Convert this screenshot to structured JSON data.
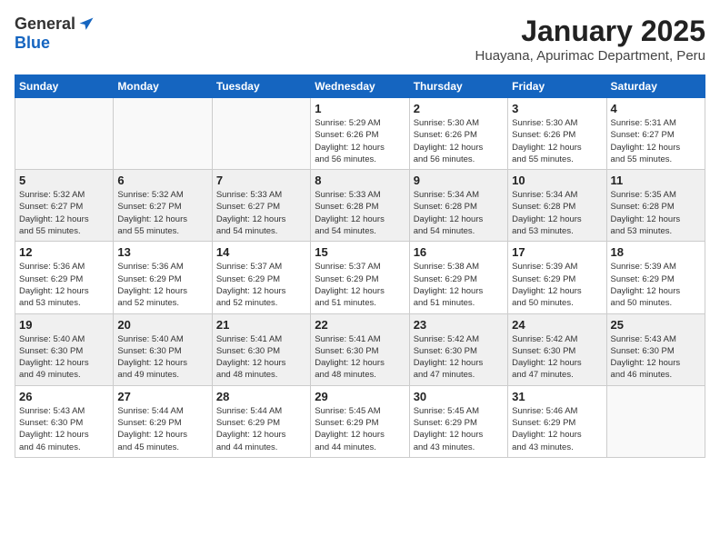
{
  "header": {
    "logo_general": "General",
    "logo_blue": "Blue",
    "month_title": "January 2025",
    "subtitle": "Huayana, Apurimac Department, Peru"
  },
  "weekdays": [
    "Sunday",
    "Monday",
    "Tuesday",
    "Wednesday",
    "Thursday",
    "Friday",
    "Saturday"
  ],
  "weeks": [
    {
      "shaded": false,
      "days": [
        {
          "num": "",
          "info": ""
        },
        {
          "num": "",
          "info": ""
        },
        {
          "num": "",
          "info": ""
        },
        {
          "num": "1",
          "info": "Sunrise: 5:29 AM\nSunset: 6:26 PM\nDaylight: 12 hours\nand 56 minutes."
        },
        {
          "num": "2",
          "info": "Sunrise: 5:30 AM\nSunset: 6:26 PM\nDaylight: 12 hours\nand 56 minutes."
        },
        {
          "num": "3",
          "info": "Sunrise: 5:30 AM\nSunset: 6:26 PM\nDaylight: 12 hours\nand 55 minutes."
        },
        {
          "num": "4",
          "info": "Sunrise: 5:31 AM\nSunset: 6:27 PM\nDaylight: 12 hours\nand 55 minutes."
        }
      ]
    },
    {
      "shaded": true,
      "days": [
        {
          "num": "5",
          "info": "Sunrise: 5:32 AM\nSunset: 6:27 PM\nDaylight: 12 hours\nand 55 minutes."
        },
        {
          "num": "6",
          "info": "Sunrise: 5:32 AM\nSunset: 6:27 PM\nDaylight: 12 hours\nand 55 minutes."
        },
        {
          "num": "7",
          "info": "Sunrise: 5:33 AM\nSunset: 6:27 PM\nDaylight: 12 hours\nand 54 minutes."
        },
        {
          "num": "8",
          "info": "Sunrise: 5:33 AM\nSunset: 6:28 PM\nDaylight: 12 hours\nand 54 minutes."
        },
        {
          "num": "9",
          "info": "Sunrise: 5:34 AM\nSunset: 6:28 PM\nDaylight: 12 hours\nand 54 minutes."
        },
        {
          "num": "10",
          "info": "Sunrise: 5:34 AM\nSunset: 6:28 PM\nDaylight: 12 hours\nand 53 minutes."
        },
        {
          "num": "11",
          "info": "Sunrise: 5:35 AM\nSunset: 6:28 PM\nDaylight: 12 hours\nand 53 minutes."
        }
      ]
    },
    {
      "shaded": false,
      "days": [
        {
          "num": "12",
          "info": "Sunrise: 5:36 AM\nSunset: 6:29 PM\nDaylight: 12 hours\nand 53 minutes."
        },
        {
          "num": "13",
          "info": "Sunrise: 5:36 AM\nSunset: 6:29 PM\nDaylight: 12 hours\nand 52 minutes."
        },
        {
          "num": "14",
          "info": "Sunrise: 5:37 AM\nSunset: 6:29 PM\nDaylight: 12 hours\nand 52 minutes."
        },
        {
          "num": "15",
          "info": "Sunrise: 5:37 AM\nSunset: 6:29 PM\nDaylight: 12 hours\nand 51 minutes."
        },
        {
          "num": "16",
          "info": "Sunrise: 5:38 AM\nSunset: 6:29 PM\nDaylight: 12 hours\nand 51 minutes."
        },
        {
          "num": "17",
          "info": "Sunrise: 5:39 AM\nSunset: 6:29 PM\nDaylight: 12 hours\nand 50 minutes."
        },
        {
          "num": "18",
          "info": "Sunrise: 5:39 AM\nSunset: 6:29 PM\nDaylight: 12 hours\nand 50 minutes."
        }
      ]
    },
    {
      "shaded": true,
      "days": [
        {
          "num": "19",
          "info": "Sunrise: 5:40 AM\nSunset: 6:30 PM\nDaylight: 12 hours\nand 49 minutes."
        },
        {
          "num": "20",
          "info": "Sunrise: 5:40 AM\nSunset: 6:30 PM\nDaylight: 12 hours\nand 49 minutes."
        },
        {
          "num": "21",
          "info": "Sunrise: 5:41 AM\nSunset: 6:30 PM\nDaylight: 12 hours\nand 48 minutes."
        },
        {
          "num": "22",
          "info": "Sunrise: 5:41 AM\nSunset: 6:30 PM\nDaylight: 12 hours\nand 48 minutes."
        },
        {
          "num": "23",
          "info": "Sunrise: 5:42 AM\nSunset: 6:30 PM\nDaylight: 12 hours\nand 47 minutes."
        },
        {
          "num": "24",
          "info": "Sunrise: 5:42 AM\nSunset: 6:30 PM\nDaylight: 12 hours\nand 47 minutes."
        },
        {
          "num": "25",
          "info": "Sunrise: 5:43 AM\nSunset: 6:30 PM\nDaylight: 12 hours\nand 46 minutes."
        }
      ]
    },
    {
      "shaded": false,
      "days": [
        {
          "num": "26",
          "info": "Sunrise: 5:43 AM\nSunset: 6:30 PM\nDaylight: 12 hours\nand 46 minutes."
        },
        {
          "num": "27",
          "info": "Sunrise: 5:44 AM\nSunset: 6:29 PM\nDaylight: 12 hours\nand 45 minutes."
        },
        {
          "num": "28",
          "info": "Sunrise: 5:44 AM\nSunset: 6:29 PM\nDaylight: 12 hours\nand 44 minutes."
        },
        {
          "num": "29",
          "info": "Sunrise: 5:45 AM\nSunset: 6:29 PM\nDaylight: 12 hours\nand 44 minutes."
        },
        {
          "num": "30",
          "info": "Sunrise: 5:45 AM\nSunset: 6:29 PM\nDaylight: 12 hours\nand 43 minutes."
        },
        {
          "num": "31",
          "info": "Sunrise: 5:46 AM\nSunset: 6:29 PM\nDaylight: 12 hours\nand 43 minutes."
        },
        {
          "num": "",
          "info": ""
        }
      ]
    }
  ]
}
